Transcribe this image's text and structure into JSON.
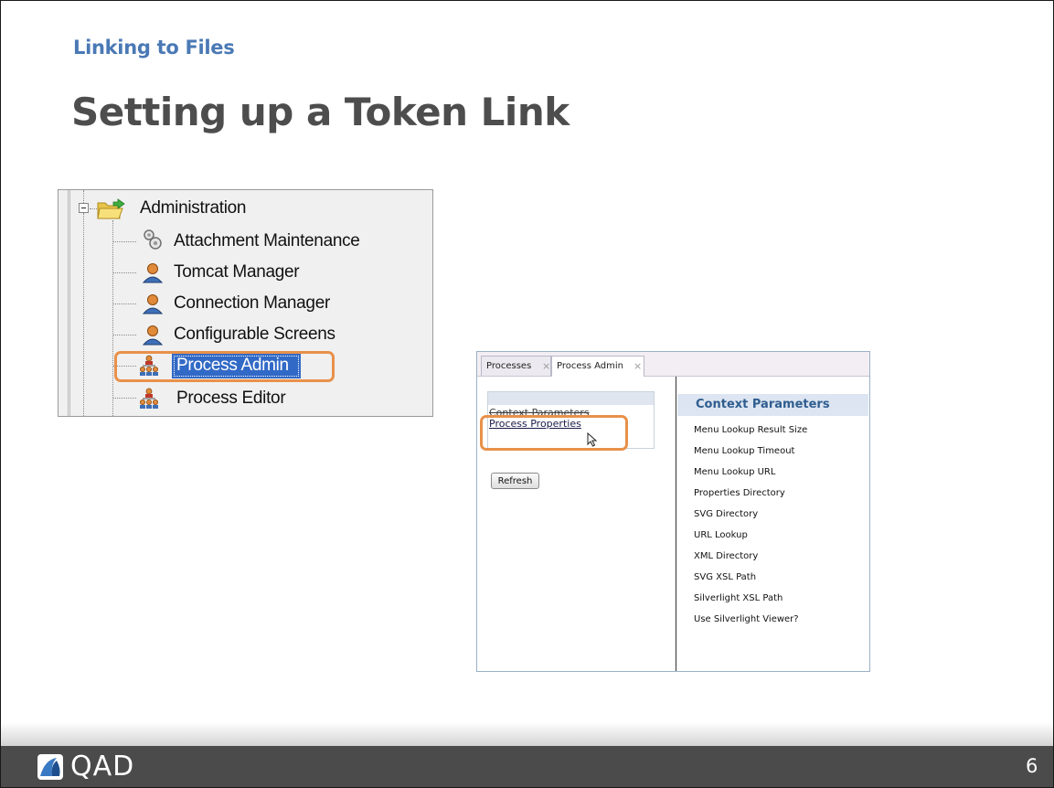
{
  "slide": {
    "section_title": "Linking to Files",
    "main_title": "Setting up a Token Link",
    "page_number": "6"
  },
  "tree": {
    "root": {
      "label": "Administration",
      "icon": "folder-icon"
    },
    "items": [
      {
        "label": "Attachment Maintenance",
        "icon": "gears-icon"
      },
      {
        "label": "Tomcat Manager",
        "icon": "user-icon"
      },
      {
        "label": "Connection Manager",
        "icon": "user-icon"
      },
      {
        "label": "Configurable Screens",
        "icon": "user-icon"
      },
      {
        "label": "Process Admin",
        "icon": "group-icon",
        "selected": true
      },
      {
        "label": "Process Editor",
        "icon": "group-icon"
      }
    ]
  },
  "app": {
    "tabs": [
      {
        "label": "Processes",
        "close": "×"
      },
      {
        "label": "Process Admin",
        "close": "×"
      }
    ],
    "left_list": {
      "item_strike": "Context Parameters",
      "item_link": "Process Properties"
    },
    "refresh_label": "Refresh",
    "context_header": "Context Parameters",
    "context_items": [
      "Menu Lookup Result Size",
      "Menu Lookup Timeout",
      "Menu Lookup URL",
      "Properties Directory",
      "SVG Directory",
      "URL Lookup",
      "XML Directory",
      "SVG XSL Path",
      "Silverlight XSL Path",
      "Use Silverlight Viewer?"
    ]
  },
  "footer": {
    "brand": "QAD",
    "logo_icon": "qad-logo-icon"
  },
  "colors": {
    "section_title": "#4a79b5",
    "main_title": "#4d4d4d",
    "highlight": "#e8914a",
    "selection": "#3169c6",
    "footer": "#4b4b4b"
  }
}
